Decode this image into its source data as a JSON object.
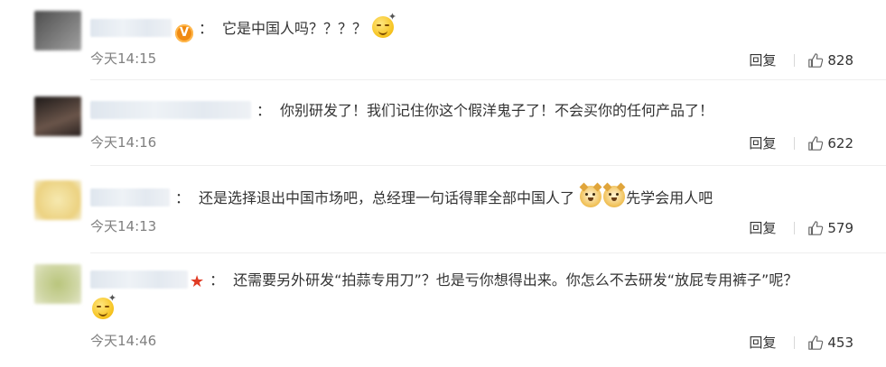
{
  "comments": [
    {
      "avatar_colors": [
        "#5a5a5a",
        "#9a9a9a"
      ],
      "badge": "v",
      "colon": "：",
      "text": "它是中国人吗？？？？",
      "emoji_after": [
        "smirk-emoji"
      ],
      "time": "今天14:15",
      "reply_label": "回复",
      "likes": "828"
    },
    {
      "avatar_colors": [
        "#2a2422",
        "#5c4a40"
      ],
      "badge": "",
      "colon": "：",
      "text": "你别研发了！我们记住你这个假洋鬼子了！不会买你的任何产品了！",
      "emoji_after": [],
      "time": "今天14:16",
      "reply_label": "回复",
      "likes": "622"
    },
    {
      "avatar_colors": [
        "#f2e6b8",
        "#e8c86a"
      ],
      "badge": "",
      "colon": "：",
      "text": "还是选择退出中国市场吧，总经理一句话得罪全部中国人了",
      "text_after": "先学会用人吧",
      "emoji_after": [
        "doge-emoji",
        "doge-emoji"
      ],
      "time": "今天14:13",
      "reply_label": "回复",
      "likes": "579"
    },
    {
      "avatar_colors": [
        "#c9d29a",
        "#a8b46a"
      ],
      "badge": "star",
      "colon": "：",
      "text": "还需要另外研发“拍蒜专用刀”？也是亏你想得出来。你怎么不去研发“放屁专用裤子”呢？",
      "emoji_after": [
        "smirk-emoji"
      ],
      "time": "今天14:46",
      "reply_label": "回复",
      "likes": "453"
    }
  ],
  "colors": {
    "time_text": "#808080",
    "badge_v": "#f08a12",
    "badge_star": "#e03b24"
  }
}
